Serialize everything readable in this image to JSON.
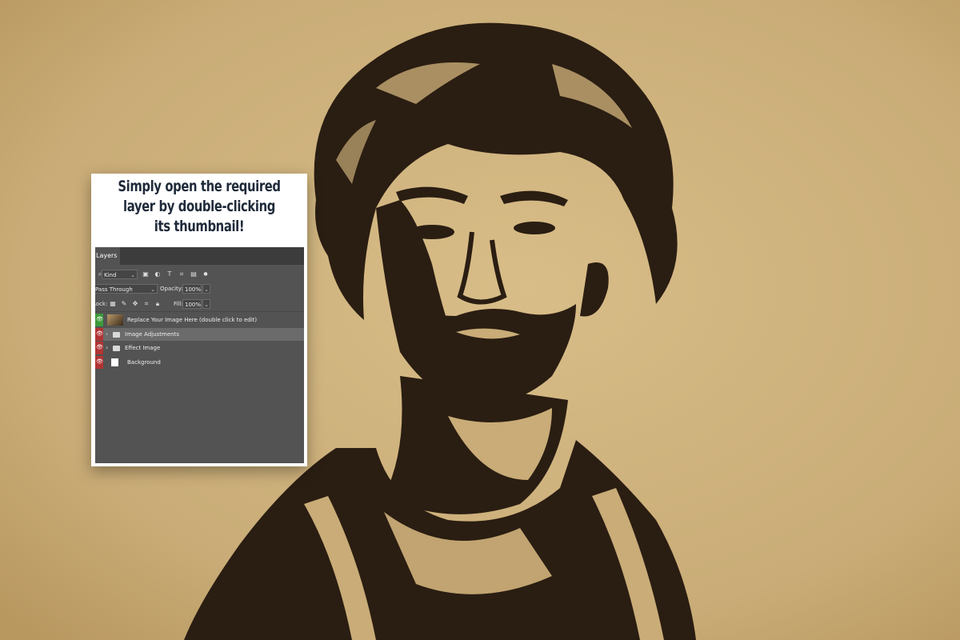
{
  "card": {
    "title_lines": [
      "Simply open the required",
      "layer by double-clicking",
      "its thumbnail!"
    ]
  },
  "panel": {
    "tab_label": "Layers",
    "filter_kind": "Kind",
    "blend_mode": "Pass Through",
    "opacity_label": "Opacity:",
    "opacity_value": "100%",
    "lock_label": "Lock:",
    "fill_label": "Fill:",
    "fill_value": "100%",
    "layers": [
      {
        "name": "Replace Your Image Here (double click to edit)",
        "eye_color": "#3d9a3a"
      },
      {
        "name": "Image Adjustments",
        "eye_color": "#b23434"
      },
      {
        "name": "Effect Image",
        "eye_color": "#b23434"
      },
      {
        "name": "Background",
        "eye_color": "#b23434"
      }
    ]
  },
  "colors": {
    "paper": "#c9ac77",
    "ink": "#2a1d12",
    "panel_bg": "#535353"
  },
  "icons": [
    "search-icon",
    "image-filter-icon",
    "adjustment-filter-icon",
    "type-filter-icon",
    "shape-filter-icon",
    "smart-object-filter-icon",
    "eye-icon",
    "folder-icon",
    "lock-icon"
  ]
}
